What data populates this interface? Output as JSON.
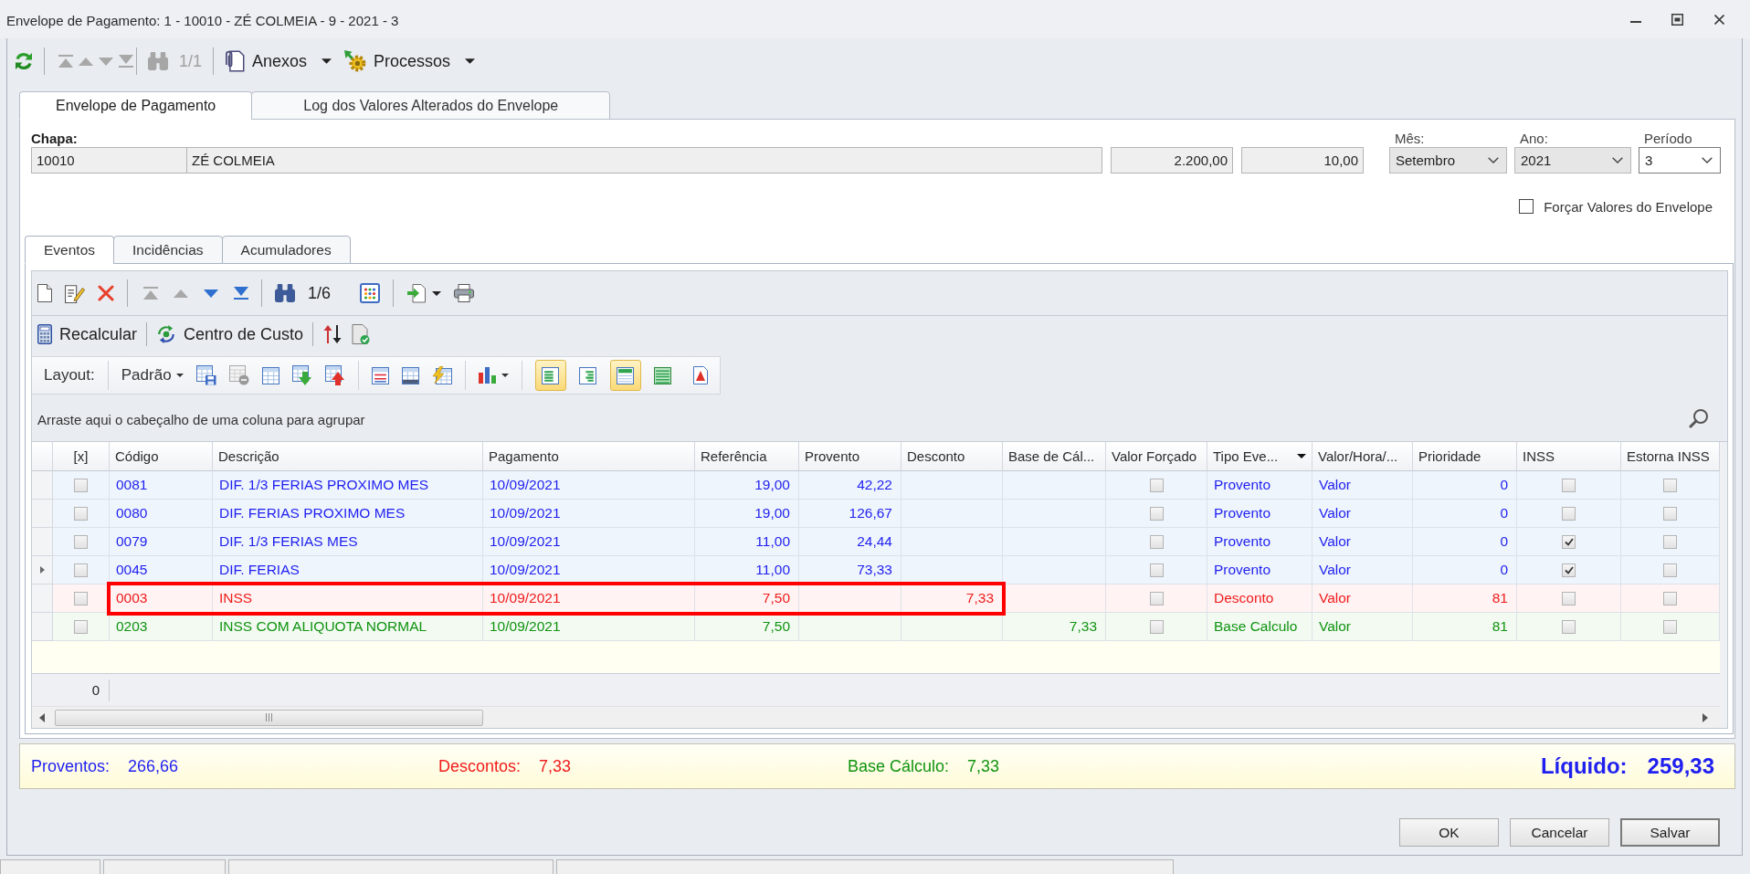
{
  "window": {
    "title": "Envelope de Pagamento: 1 - 10010 - ZÉ COLMEIA - 9 - 2021 - 3"
  },
  "toolbar": {
    "nav": [
      {
        "disabled": true
      },
      {
        "disabled": true
      },
      {
        "disabled": true
      },
      {
        "disabled": true
      }
    ],
    "find": {
      "disabled": true,
      "counter": "1/1"
    },
    "menus": [
      {
        "label": "Anexos"
      },
      {
        "label": "Processos"
      }
    ]
  },
  "tabs": [
    {
      "label": "Envelope de Pagamento",
      "selected": true
    },
    {
      "label": "Log dos Valores Alterados do Envelope",
      "selected": false
    }
  ],
  "employee": {
    "label": "Chapa:",
    "fields": [
      {
        "kind": "text",
        "value": "10010"
      },
      {
        "kind": "text",
        "value": "ZÉ COLMEIA"
      },
      {
        "kind": "number",
        "value": "2.200,00"
      },
      {
        "kind": "number",
        "value": "10,00"
      }
    ]
  },
  "period": [
    {
      "label": "Mês:",
      "value": "Setembro",
      "readonly": true
    },
    {
      "label": "Ano:",
      "value": "2021",
      "readonly": true
    },
    {
      "label": "Período",
      "value": "3",
      "readonly": false
    }
  ],
  "force_values": {
    "label": "Forçar Valores do Envelope",
    "checked": false
  },
  "event_tabs": [
    {
      "label": "Eventos",
      "selected": true
    },
    {
      "label": "Incidências",
      "selected": false
    },
    {
      "label": "Acumuladores",
      "selected": false
    }
  ],
  "events_toolbar": {
    "nav": [
      {
        "disabled": true
      },
      {
        "disabled": true
      },
      {
        "disabled": false
      },
      {
        "disabled": false
      }
    ],
    "counter": "1/6"
  },
  "actions": [
    {
      "label": "Recalcular"
    },
    {
      "label": "Centro de Custo"
    }
  ],
  "layout_toolbar": {
    "label": "Layout:",
    "preset": "Padrão",
    "delete_disabled": true,
    "views": [
      {
        "on": true
      },
      {
        "on": false
      },
      {
        "on": true
      },
      {
        "on": false
      },
      {
        "on": false
      }
    ]
  },
  "grid": {
    "group_hint": "Arraste aqui o cabeçalho de uma coluna para agrupar",
    "columns": [
      {
        "label": "[x]",
        "filter": false
      },
      {
        "label": "Código",
        "filter": false
      },
      {
        "label": "Descrição",
        "filter": false
      },
      {
        "label": "Pagamento",
        "filter": false
      },
      {
        "label": "Referência",
        "filter": false
      },
      {
        "label": "Provento",
        "filter": false
      },
      {
        "label": "Desconto",
        "filter": false
      },
      {
        "label": "Base de Cál...",
        "filter": false
      },
      {
        "label": "Valor Forçado",
        "filter": false
      },
      {
        "label": "Tipo Eve...",
        "filter": true
      },
      {
        "label": "Valor/Hora/...",
        "filter": false
      },
      {
        "label": "Prioridade",
        "filter": false
      },
      {
        "label": "INSS",
        "filter": false
      },
      {
        "label": "Estorna INSS",
        "filter": false
      }
    ],
    "rows": [
      {
        "kind": "provento",
        "selected": false,
        "highlighted": false,
        "checked": false,
        "codigo": "0081",
        "descricao": "DIF. 1/3 FERIAS PROXIMO MES",
        "pagamento": "10/09/2021",
        "referencia": "19,00",
        "provento": "42,22",
        "valor_forcado": false,
        "tipo": "Provento",
        "valor_hora": "Valor",
        "prioridade": "0",
        "inss": false,
        "estorna_inss": false
      },
      {
        "kind": "provento",
        "selected": false,
        "highlighted": false,
        "checked": false,
        "codigo": "0080",
        "descricao": "DIF. FERIAS PROXIMO MES",
        "pagamento": "10/09/2021",
        "referencia": "19,00",
        "provento": "126,67",
        "valor_forcado": false,
        "tipo": "Provento",
        "valor_hora": "Valor",
        "prioridade": "0",
        "inss": false,
        "estorna_inss": false
      },
      {
        "kind": "provento",
        "selected": false,
        "highlighted": false,
        "checked": false,
        "codigo": "0079",
        "descricao": "DIF. 1/3 FERIAS MES",
        "pagamento": "10/09/2021",
        "referencia": "11,00",
        "provento": "24,44",
        "valor_forcado": false,
        "tipo": "Provento",
        "valor_hora": "Valor",
        "prioridade": "0",
        "inss": true,
        "estorna_inss": false
      },
      {
        "kind": "provento",
        "selected": true,
        "highlighted": false,
        "checked": false,
        "codigo": "0045",
        "descricao": "DIF. FERIAS",
        "pagamento": "10/09/2021",
        "referencia": "11,00",
        "provento": "73,33",
        "valor_forcado": false,
        "tipo": "Provento",
        "valor_hora": "Valor",
        "prioridade": "0",
        "inss": true,
        "estorna_inss": false
      },
      {
        "kind": "desconto",
        "selected": false,
        "highlighted": true,
        "checked": false,
        "codigo": "0003",
        "descricao": "INSS",
        "pagamento": "10/09/2021",
        "referencia": "7,50",
        "desconto": "7,33",
        "valor_forcado": false,
        "tipo": "Desconto",
        "valor_hora": "Valor",
        "prioridade": "81",
        "inss": false,
        "estorna_inss": false
      },
      {
        "kind": "base",
        "selected": false,
        "highlighted": false,
        "checked": false,
        "codigo": "0203",
        "descricao": "INSS COM ALIQUOTA NORMAL",
        "pagamento": "10/09/2021",
        "referencia": "7,50",
        "base": "7,33",
        "valor_forcado": false,
        "tipo": "Base Calculo",
        "valor_hora": "Valor",
        "prioridade": "81",
        "inss": false,
        "estorna_inss": false
      }
    ],
    "footer_count": "0"
  },
  "summary": [
    {
      "kind": "provento",
      "label": "Proventos:",
      "value": "266,66"
    },
    {
      "kind": "desconto",
      "label": "Descontos:",
      "value": "7,33"
    },
    {
      "kind": "base",
      "label": "Base Cálculo:",
      "value": "7,33"
    },
    {
      "kind": "liquido",
      "label": "Líquido:",
      "value": "259,33"
    }
  ],
  "buttons": [
    {
      "label": "OK",
      "focused": false
    },
    {
      "label": "Cancelar",
      "focused": false
    },
    {
      "label": "Salvar",
      "focused": true
    }
  ]
}
